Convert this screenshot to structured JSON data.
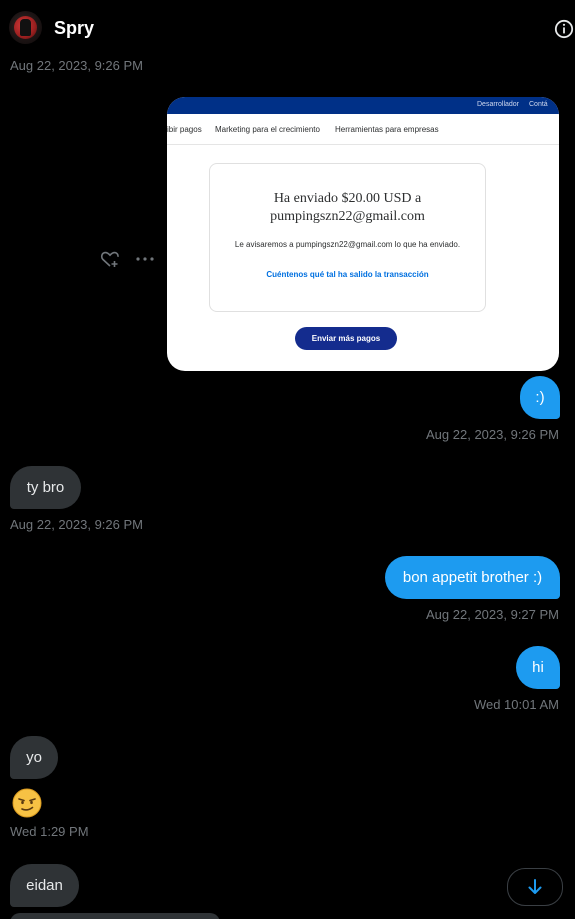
{
  "header": {
    "contact_name": "Spry"
  },
  "messages": [
    {
      "kind": "timestamp",
      "text": "Aug 22, 2023, 9:26 PM"
    },
    {
      "kind": "image",
      "screenshot": {
        "top_links": [
          "Desarrollador",
          "Contá"
        ],
        "nav_items": [
          "ibir pagos",
          "Marketing para el crecimiento",
          "Herramientas para empresas"
        ],
        "title_line1": "Ha enviado $20.00 USD a",
        "title_line2": "pumpingszn22@gmail.com",
        "body": "Le avisaremos a pumpingszn22@gmail.com lo que ha enviado.",
        "link": "Cuéntenos qué tal ha salido la transacción",
        "button": "Enviar más pagos"
      }
    },
    {
      "kind": "sent",
      "text": ":)"
    },
    {
      "kind": "timestamp",
      "text": "Aug 22, 2023, 9:26 PM"
    },
    {
      "kind": "received",
      "text": "ty bro"
    },
    {
      "kind": "timestamp",
      "text": "Aug 22, 2023, 9:26 PM"
    },
    {
      "kind": "sent",
      "text": "bon appetit brother :)"
    },
    {
      "kind": "timestamp",
      "text": "Aug 22, 2023, 9:27 PM"
    },
    {
      "kind": "sent",
      "text": "hi"
    },
    {
      "kind": "timestamp",
      "text": "Wed 10:01 AM"
    },
    {
      "kind": "received",
      "text": "yo"
    },
    {
      "kind": "emoji",
      "icon": "smirking-face-emoji"
    },
    {
      "kind": "timestamp",
      "text": "Wed 1:29 PM"
    },
    {
      "kind": "received",
      "text": "eidan"
    }
  ],
  "colors": {
    "sent_bubble": "#1d9bf0",
    "received_bubble": "#2f3336",
    "timestamp": "#71767b",
    "paypal_navy": "#003087"
  },
  "icons": [
    "info-icon",
    "like-add-icon",
    "more-icon",
    "arrow-down-icon"
  ]
}
